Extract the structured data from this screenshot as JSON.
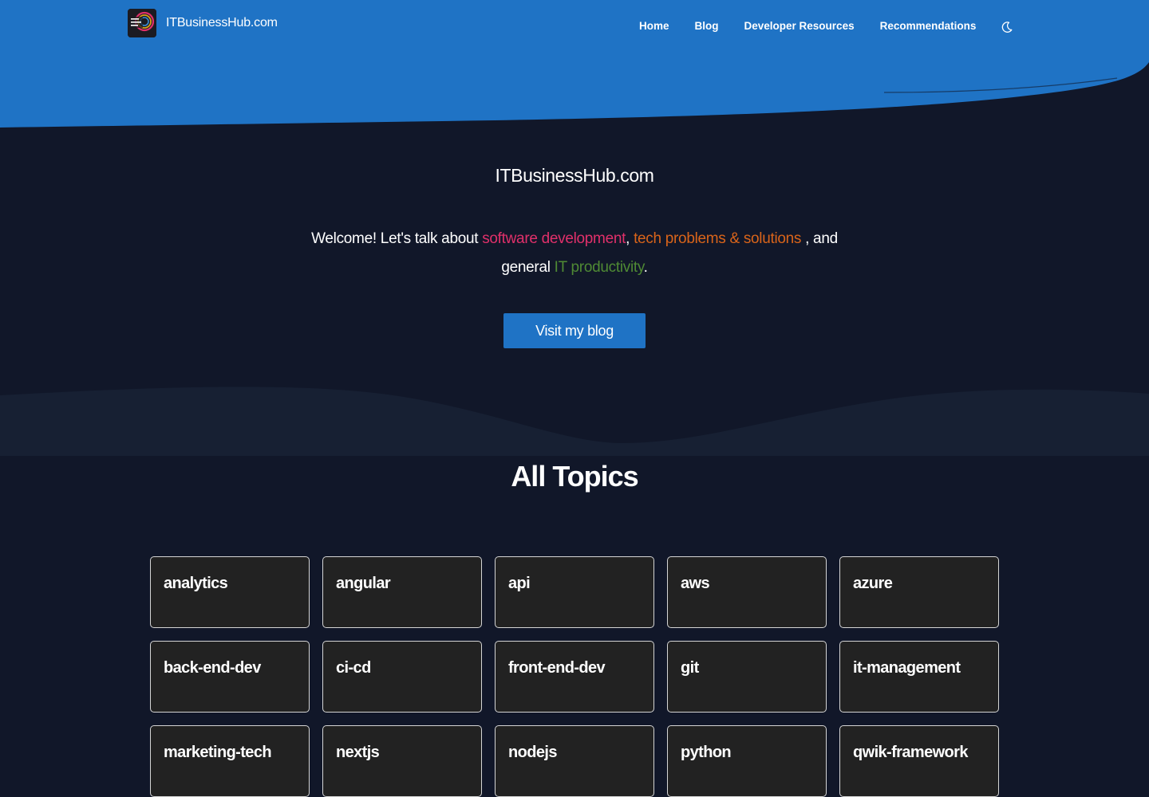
{
  "colors": {
    "header_blue": "#1f73c5",
    "page_bg": "#111729",
    "card_bg": "#222222",
    "accent_pink": "#e0306a",
    "accent_orange": "#d9641a",
    "accent_green": "#4f8a34"
  },
  "header": {
    "brand_name": "ITBusinessHub.com",
    "logo_icon": "itbusinesshub-logo",
    "nav": [
      {
        "label": "Home"
      },
      {
        "label": "Blog"
      },
      {
        "label": "Developer Resources"
      },
      {
        "label": "Recommendations"
      }
    ],
    "theme_toggle_icon": "moon-icon"
  },
  "hero": {
    "title": "ITBusinessHub.com",
    "intro_prefix": "Welcome! Let's talk about ",
    "link_software": "software development",
    "sep_comma": ", ",
    "link_tech": "tech problems & solutions",
    "mid_text": " , and general ",
    "link_it": "IT productivity",
    "end_period": ".",
    "cta_label": "Visit my blog"
  },
  "topics": {
    "heading": "All Topics",
    "items": [
      "analytics",
      "angular",
      "api",
      "aws",
      "azure",
      "back-end-dev",
      "ci-cd",
      "front-end-dev",
      "git",
      "it-management",
      "marketing-tech",
      "nextjs",
      "nodejs",
      "python",
      "qwik-framework"
    ]
  }
}
